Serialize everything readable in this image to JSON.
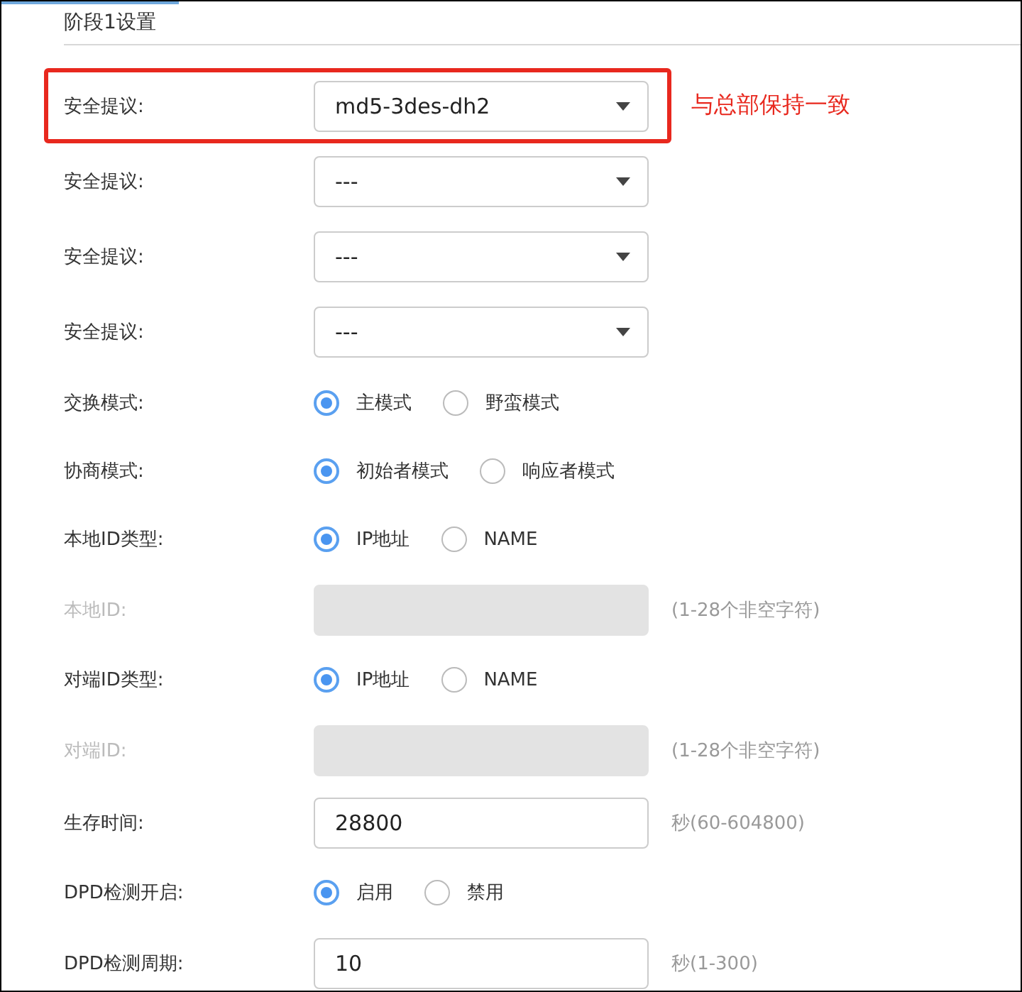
{
  "section_title": "阶段1设置",
  "rows": [
    {
      "kind": "select",
      "label": "安全提议:",
      "value": "md5-3des-dh2",
      "highlighted": true,
      "note": "与总部保持一致"
    },
    {
      "kind": "select",
      "label": "安全提议:",
      "value": "---",
      "highlighted": false
    },
    {
      "kind": "select",
      "label": "安全提议:",
      "value": "---",
      "highlighted": false
    },
    {
      "kind": "select",
      "label": "安全提议:",
      "value": "---",
      "highlighted": false
    },
    {
      "kind": "radio",
      "label": "交换模式:",
      "options": [
        {
          "label": "主模式",
          "selected": true
        },
        {
          "label": "野蛮模式",
          "selected": false
        }
      ]
    },
    {
      "kind": "radio",
      "label": "协商模式:",
      "options": [
        {
          "label": "初始者模式",
          "selected": true
        },
        {
          "label": "响应者模式",
          "selected": false
        }
      ]
    },
    {
      "kind": "radio",
      "label": "本地ID类型:",
      "options": [
        {
          "label": "IP地址",
          "selected": true
        },
        {
          "label": "NAME",
          "selected": false
        }
      ]
    },
    {
      "kind": "field",
      "label": "本地ID:",
      "disabled": true,
      "hint": "(1-28个非空字符)"
    },
    {
      "kind": "radio",
      "label": "对端ID类型:",
      "options": [
        {
          "label": "IP地址",
          "selected": true
        },
        {
          "label": "NAME",
          "selected": false
        }
      ]
    },
    {
      "kind": "field",
      "label": "对端ID:",
      "disabled": true,
      "hint": "(1-28个非空字符)"
    },
    {
      "kind": "field",
      "label": "生存时间:",
      "value": "28800",
      "disabled": false,
      "hint": "秒(60-604800)"
    },
    {
      "kind": "radio",
      "label": "DPD检测开启:",
      "options": [
        {
          "label": "启用",
          "selected": true
        },
        {
          "label": "禁用",
          "selected": false
        }
      ]
    },
    {
      "kind": "field",
      "label": "DPD检测周期:",
      "value": "10",
      "disabled": false,
      "hint": "秒(1-300)"
    }
  ]
}
